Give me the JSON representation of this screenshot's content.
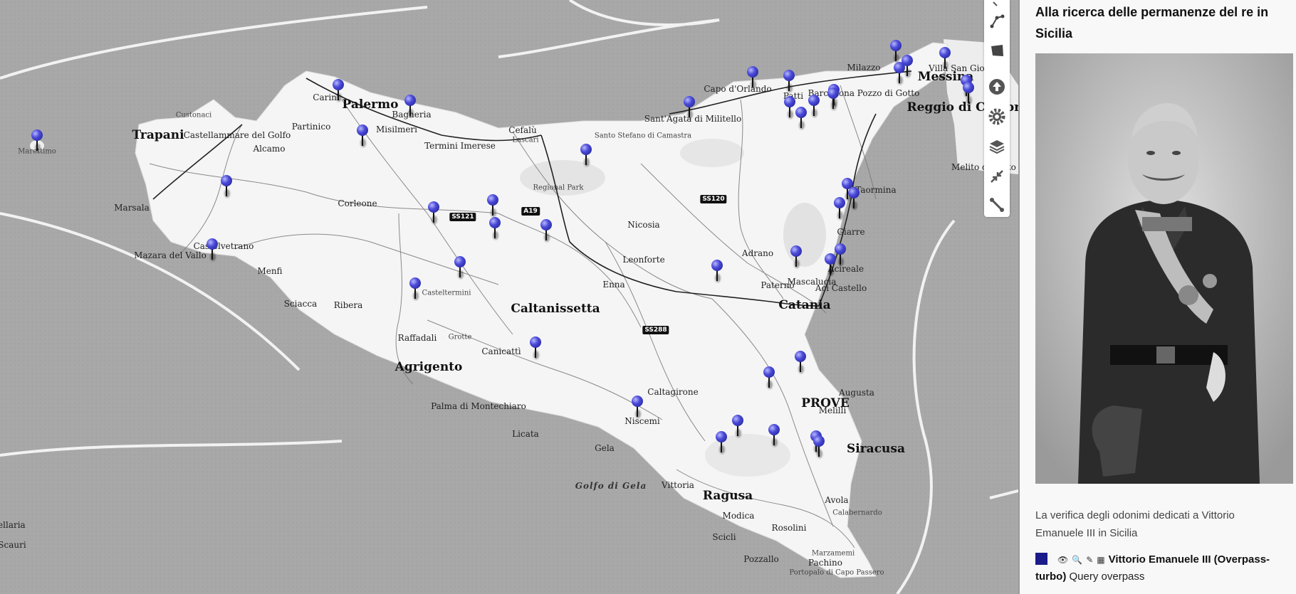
{
  "colors": {
    "sea": "#a6a6a6",
    "land": "#f4f4f4",
    "pin": "#2d2dbf",
    "panel_bg": "#f8f8f8",
    "legend_swatch": "#1b1b8a"
  },
  "panel": {
    "title": "Alla ricerca delle permanenze del re in Sicilia",
    "description": "La verifica degli odonimi dedicati a Vittorio Emanuele III in Sicilia",
    "portrait_alt": "Vittorio Emanuele III",
    "layer": {
      "name": "Vittorio Emanuele III (Overpass-turbo)",
      "type": "Query overpass"
    }
  },
  "toolbar": [
    {
      "name": "draw-line-tool",
      "icon": "polyline-icon"
    },
    {
      "name": "draw-polygon-tool",
      "icon": "polygon-icon"
    },
    {
      "name": "upload-button",
      "icon": "upload-icon"
    },
    {
      "name": "settings-button",
      "icon": "gear-icon"
    },
    {
      "name": "layers-button",
      "icon": "layers-icon"
    },
    {
      "name": "collapse-button",
      "icon": "collapse-icon"
    },
    {
      "name": "measure-button",
      "icon": "ruler-icon"
    }
  ],
  "places": {
    "trapani": "Trapani",
    "palermo": "Palermo",
    "messina": "Messina",
    "reggio": "Reggio di Calabria",
    "catania": "Catania",
    "caltanissetta": "Caltanissetta",
    "agrigento": "Agrigento",
    "ragusa": "Ragusa",
    "siracusa": "Siracusa",
    "prove": "PROVE",
    "marettimo": "Marettimo",
    "custonaci": "Custonaci",
    "castellammare": "Castellammare del Golfo",
    "partinico": "Partinico",
    "alcamo": "Alcamo",
    "carini": "Carini",
    "bagheria": "Bagheria",
    "misilmeri": "Misilmeri",
    "termini": "Termini Imerese",
    "cefalu": "Cefalù",
    "lascari": "Lascari",
    "santo_stefano": "Santo Stefano di Camastra",
    "santagata": "Sant'Agata di Militello",
    "capo_orlando": "Capo d'Orlando",
    "patti": "Patti",
    "barcellona": "Barcellona Pozzo di Gotto",
    "milazzo": "Milazzo",
    "villa": "Villa San Giovanni",
    "taormina": "Taormina",
    "giarre": "Giarre",
    "acireale": "Acireale",
    "aci_castello": "Aci Castello",
    "mascalucia": "Mascalucia",
    "paterno": "Paternò",
    "adrano": "Adrano",
    "nicosia": "Nicosia",
    "leonforte": "Leonforte",
    "enna": "Enna",
    "corleone": "Corleone",
    "marsala": "Marsala",
    "mazara": "Mazara del Vallo",
    "castelvetrano": "Castelvetrano",
    "menfi": "Menfi",
    "sciacca": "Sciacca",
    "ribera": "Ribera",
    "casteltermini": "Casteltermini",
    "raffadali": "Raffadali",
    "grotte": "Grotte",
    "canicatti": "Canicattì",
    "palma": "Palma di Montechiaro",
    "licata": "Licata",
    "gela": "Gela",
    "niscemi": "Niscemi",
    "caltagirone": "Caltagirone",
    "vittoria": "Vittoria",
    "modica": "Modica",
    "scicli": "Scicli",
    "rosolini": "Rosolini",
    "pozzallo": "Pozzallo",
    "avola": "Avola",
    "calabernardo": "Calabernardo",
    "marzamemi": "Marzamemi",
    "pachino": "Pachino",
    "portopalo": "Portopalo di Capo Passero",
    "augusta": "Augusta",
    "melilli": "Melilli",
    "melito": "Melito di Porto Salvo",
    "vellaria": "vellaria",
    "scauri": "Scauri",
    "regional_park": "Regional Park",
    "golfo_gela": "Golfo di Gela"
  },
  "roads": {
    "ss121": "SS121",
    "a19": "A19",
    "ss120": "SS120",
    "ss288": "SS288"
  },
  "pin_count": 43
}
